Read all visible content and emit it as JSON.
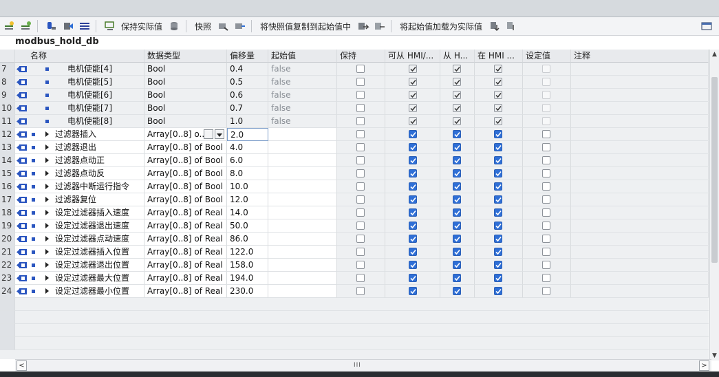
{
  "toolbar": {
    "retain_actual_label": "保持实际值",
    "snapshot_label": "快照",
    "copy_snapshot_label": "将快照值复制到起始值中",
    "load_start_label": "将起始值加载为实际值"
  },
  "db_title": "modbus_hold_db",
  "columns": {
    "name": "名称",
    "datatype": "数据类型",
    "offset": "偏移量",
    "start": "起始值",
    "retain": "保持",
    "hmi_access": "可从 HMI/...",
    "hmi_from": "从 H...",
    "hmi_in": "在 HMI ...",
    "setpoint": "设定值",
    "comment": "注释"
  },
  "rows": [
    {
      "num": "7",
      "name": "电机使能[4]",
      "type": "Bool",
      "offset": "0.4",
      "start": "false",
      "child": true
    },
    {
      "num": "8",
      "name": "电机使能[5]",
      "type": "Bool",
      "offset": "0.5",
      "start": "false",
      "child": true
    },
    {
      "num": "9",
      "name": "电机使能[6]",
      "type": "Bool",
      "offset": "0.6",
      "start": "false",
      "child": true
    },
    {
      "num": "10",
      "name": "电机使能[7]",
      "type": "Bool",
      "offset": "0.7",
      "start": "false",
      "child": true
    },
    {
      "num": "11",
      "name": "电机使能[8]",
      "type": "Bool",
      "offset": "1.0",
      "start": "false",
      "child": true
    },
    {
      "num": "12",
      "name": "过滤器插入",
      "type": "Array[0..8] o...",
      "offset": "2.0",
      "start": "",
      "child": false,
      "editing": true
    },
    {
      "num": "13",
      "name": "过滤器退出",
      "type": "Array[0..8] of Bool",
      "offset": "4.0",
      "start": "",
      "child": false
    },
    {
      "num": "14",
      "name": "过滤器点动正",
      "type": "Array[0..8] of Bool",
      "offset": "6.0",
      "start": "",
      "child": false
    },
    {
      "num": "15",
      "name": "过滤器点动反",
      "type": "Array[0..8] of Bool",
      "offset": "8.0",
      "start": "",
      "child": false
    },
    {
      "num": "16",
      "name": "过滤器中断运行指令",
      "type": "Array[0..8] of Bool",
      "offset": "10.0",
      "start": "",
      "child": false
    },
    {
      "num": "17",
      "name": "过滤器复位",
      "type": "Array[0..8] of Bool",
      "offset": "12.0",
      "start": "",
      "child": false
    },
    {
      "num": "18",
      "name": "设定过滤器插入速度",
      "type": "Array[0..8] of Real",
      "offset": "14.0",
      "start": "",
      "child": false
    },
    {
      "num": "19",
      "name": "设定过滤器退出速度",
      "type": "Array[0..8] of Real",
      "offset": "50.0",
      "start": "",
      "child": false
    },
    {
      "num": "20",
      "name": "设定过滤器点动速度",
      "type": "Array[0..8] of Real",
      "offset": "86.0",
      "start": "",
      "child": false
    },
    {
      "num": "21",
      "name": "设定过滤器插入位置",
      "type": "Array[0..8] of Real",
      "offset": "122.0",
      "start": "",
      "child": false
    },
    {
      "num": "22",
      "name": "设定过滤器退出位置",
      "type": "Array[0..8] of Real",
      "offset": "158.0",
      "start": "",
      "child": false
    },
    {
      "num": "23",
      "name": "设定过滤器最大位置",
      "type": "Array[0..8] of Real",
      "offset": "194.0",
      "start": "",
      "child": false
    },
    {
      "num": "24",
      "name": "设定过滤器最小位置",
      "type": "Array[0..8] of Real",
      "offset": "230.0",
      "start": "",
      "child": false
    }
  ],
  "colors": {
    "accent": "#2f6fd6",
    "header_bg": "#e8eaed",
    "grid_bg": "#eef0f2"
  }
}
